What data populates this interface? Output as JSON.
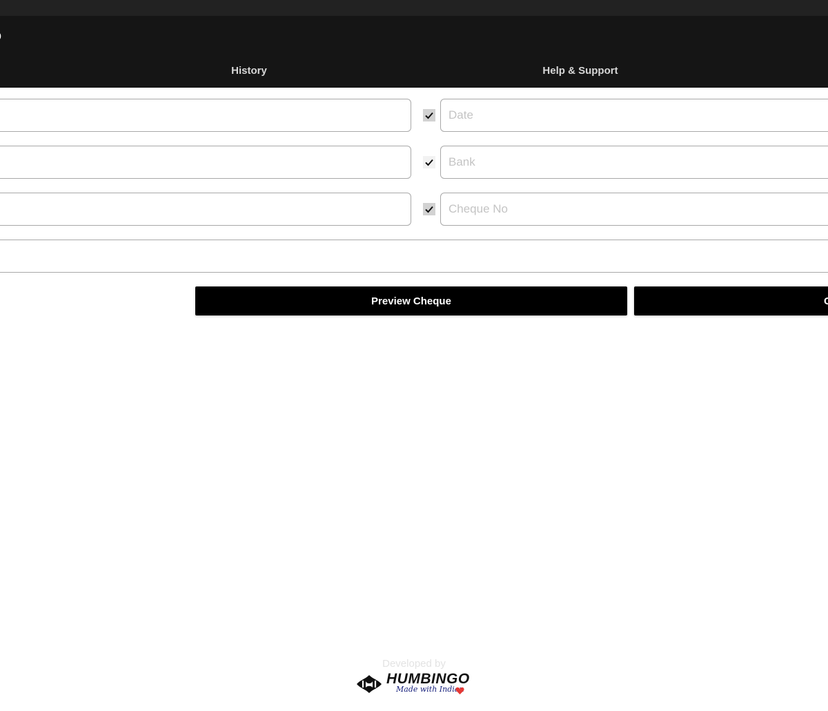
{
  "header": {
    "title": "O",
    "nav": {
      "history": "History",
      "help_support": "Help & Support"
    }
  },
  "form": {
    "date_placeholder": "Date",
    "bank_placeholder": "Bank",
    "cheque_no_placeholder": "Cheque No"
  },
  "actions": {
    "preview_label": "Preview Cheque",
    "second_label": "C"
  },
  "footer": {
    "developed_by": "Developed by",
    "brand_name": "HUMBINGO",
    "tagline": "Made with Indian"
  },
  "icons": {
    "check": "check-icon",
    "heart": "heart-icon",
    "logo": "humbingo-logo-icon"
  },
  "colors": {
    "header_bg": "#151515",
    "button_bg": "#000000",
    "heart": "#e53935"
  }
}
